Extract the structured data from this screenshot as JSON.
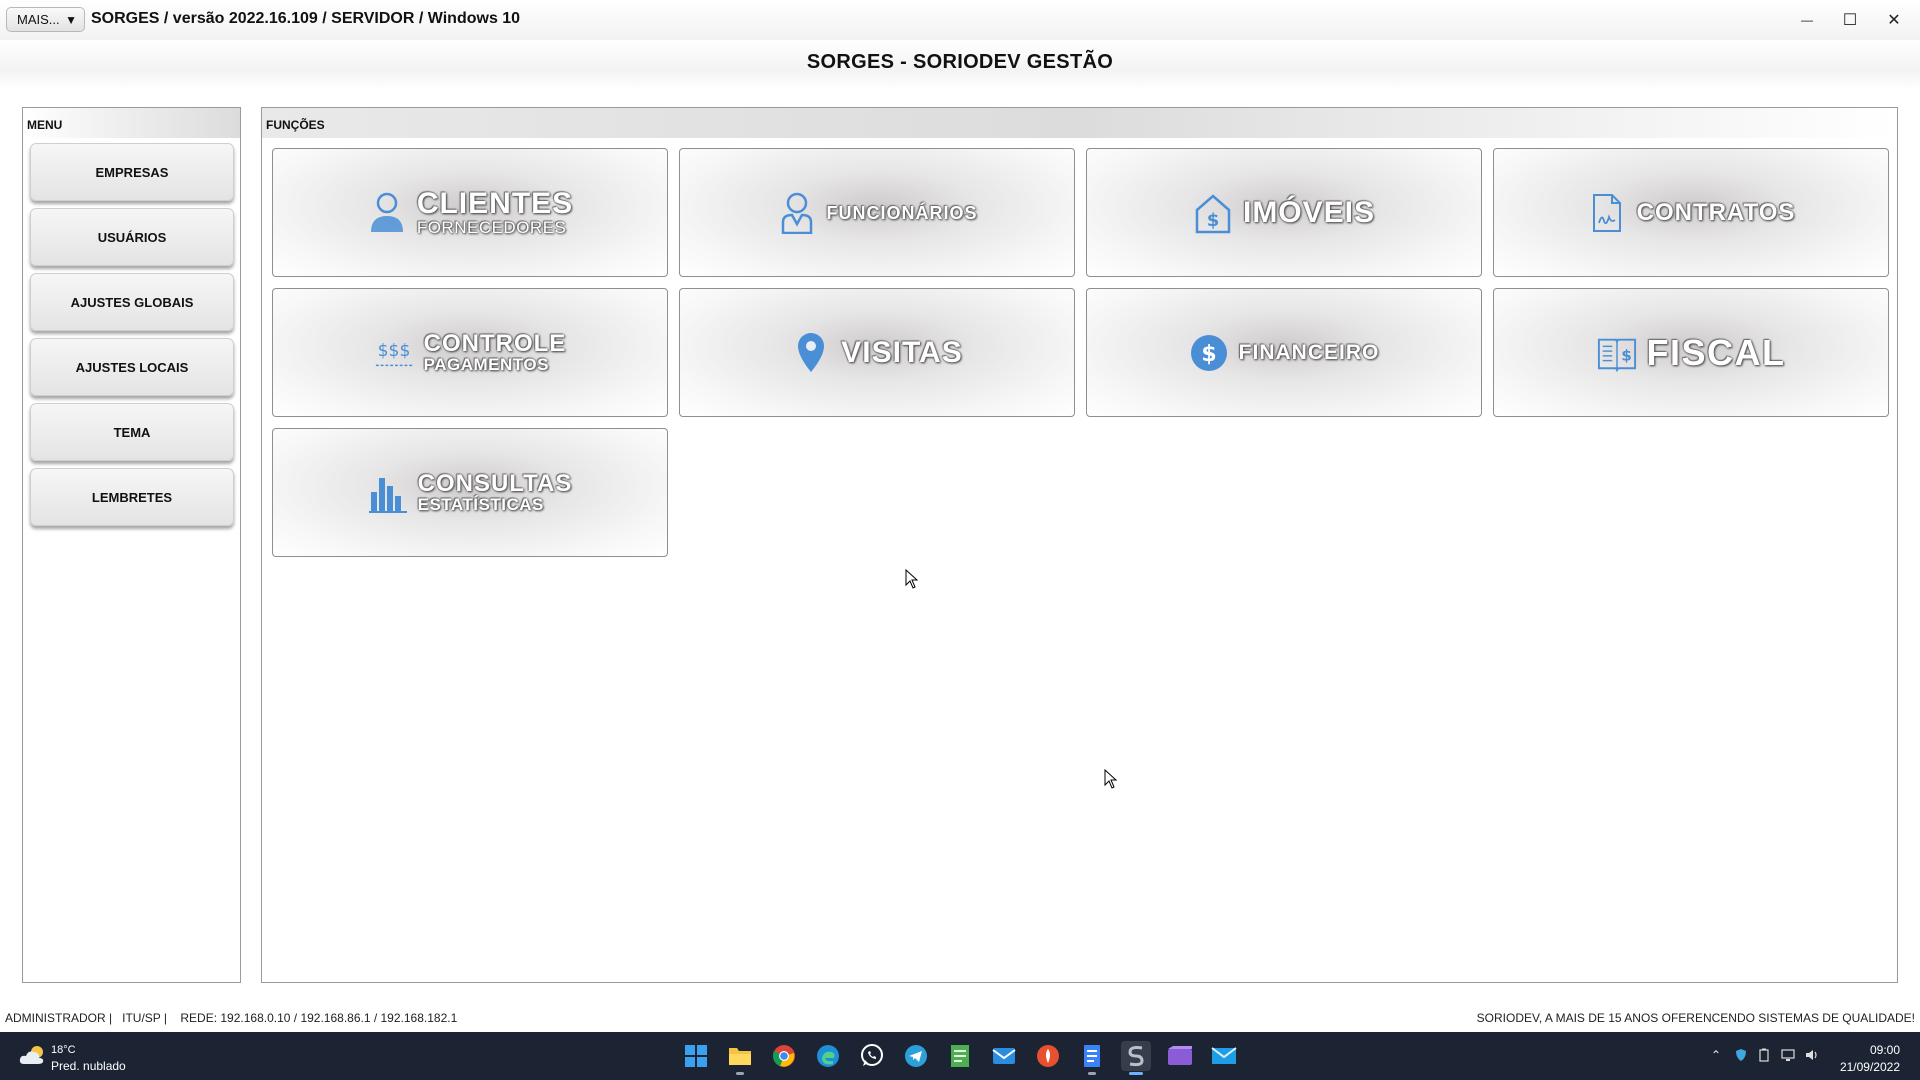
{
  "window": {
    "mais_label": "MAIS...",
    "title": "SORGES / versão 2022.16.109 / SERVIDOR / Windows 10",
    "minimize": "—",
    "maximize": "☐",
    "close": "✕"
  },
  "app_title": "SORGES - SORIODEV GESTÃO",
  "menu": {
    "header": "MENU",
    "items": [
      "EMPRESAS",
      "USUÁRIOS",
      "AJUSTES GLOBAIS",
      "AJUSTES LOCAIS",
      "TEMA",
      "LEMBRETES"
    ]
  },
  "functions": {
    "header": "FUNÇÕES",
    "tiles": [
      {
        "main": "CLIENTES",
        "sub": "FORNECEDORES",
        "icon": "person-icon"
      },
      {
        "main": "FUNCIONÁRIOS",
        "icon": "employee-icon"
      },
      {
        "main": "IMÓVEIS",
        "icon": "house-dollar-icon"
      },
      {
        "main": "CONTRATOS",
        "icon": "contract-icon"
      },
      {
        "main": "CONTROLE",
        "sub": "PAGAMENTOS",
        "icon": "dollar-signs-icon"
      },
      {
        "main": "VISITAS",
        "icon": "location-pin-icon"
      },
      {
        "main": "FINANCEIRO",
        "icon": "dollar-circle-icon"
      },
      {
        "main": "FISCAL",
        "icon": "fiscal-book-icon"
      },
      {
        "main": "CONSULTAS",
        "sub": "ESTATÍSTICAS",
        "icon": "bar-chart-icon"
      }
    ]
  },
  "status": {
    "left": "ADMINISTRADOR |   ITU/SP |    REDE: 192.168.0.10 / 192.168.86.1 / 192.168.182.1",
    "right": "SORIODEV, A MAIS DE 15 ANOS OFERENCENDO SISTEMAS DE QUALIDADE!"
  },
  "taskbar": {
    "weather_temp": "18°C",
    "weather_desc": "Pred. nublado",
    "apps": [
      "windows-start-icon",
      "file-explorer-icon",
      "chrome-icon",
      "edge-icon",
      "whatsapp-icon",
      "telegram-icon",
      "notepad-icon",
      "mail-icon",
      "app-icon",
      "document-icon",
      "sorges-icon",
      "video-editor-icon",
      "email-client-icon"
    ],
    "time": "09:00",
    "date": "21/09/2022"
  },
  "colors": {
    "icon_blue": "#4a8ed6",
    "taskbar_bg": "#1c2433"
  }
}
